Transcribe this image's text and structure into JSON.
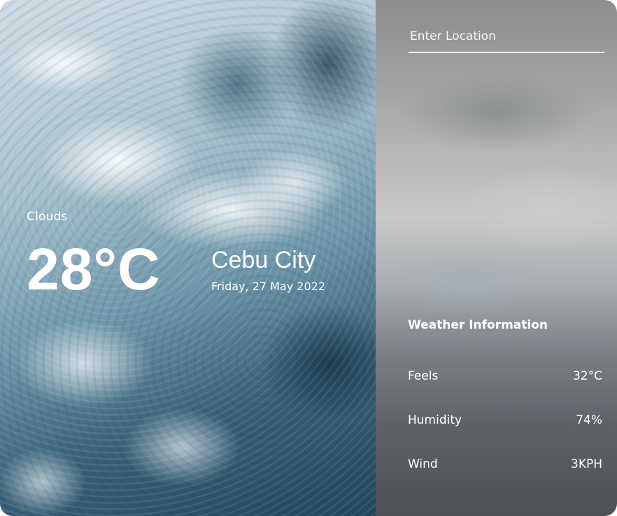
{
  "current": {
    "condition": "Clouds",
    "temperature": "28°C",
    "city": "Cebu City",
    "date": "Friday, 27 May 2022"
  },
  "search": {
    "placeholder": "Enter Location"
  },
  "info": {
    "title": "Weather Information",
    "rows": [
      {
        "label": "Feels",
        "value": "32°C"
      },
      {
        "label": "Humidity",
        "value": "74%"
      },
      {
        "label": "Wind",
        "value": "3KPH"
      }
    ]
  },
  "colors": {
    "text": "#ffffff",
    "panel_top": "#8c8d8d",
    "panel_bottom": "#4d5054",
    "ocean_dark": "#22465c"
  }
}
